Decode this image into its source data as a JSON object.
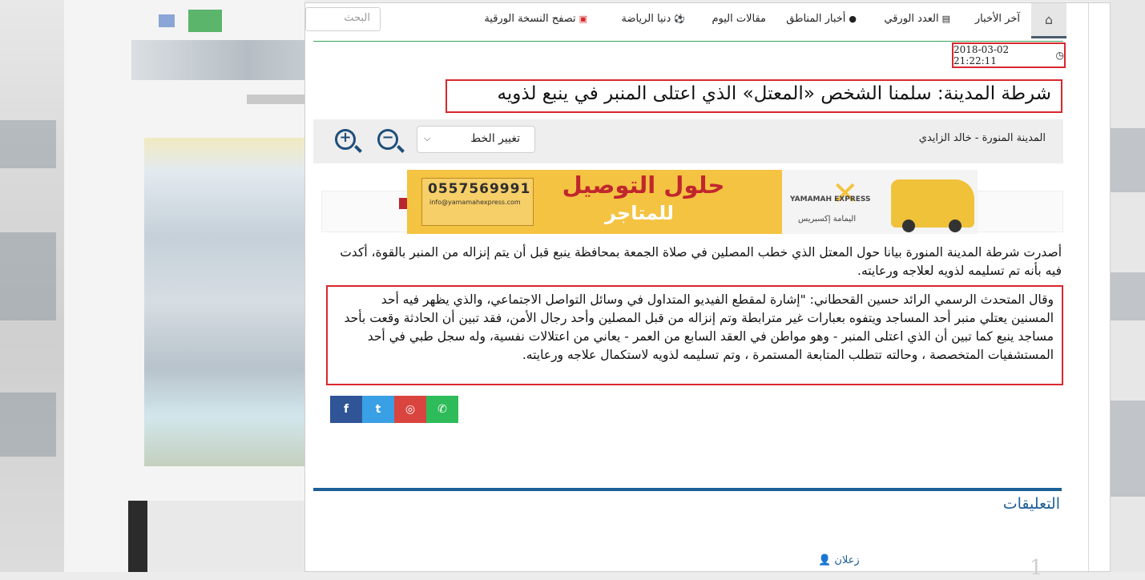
{
  "nav": {
    "home_icon": "home-icon",
    "items": [
      {
        "label": "آخر الأخبار",
        "icon": ""
      },
      {
        "label": "العدد الورقي",
        "icon": "newspaper-icon"
      },
      {
        "label": "أخبار المناطق",
        "icon": "map-marker-icon"
      },
      {
        "label": "مقالات اليوم",
        "icon": ""
      },
      {
        "label": "دنيا الرياضة",
        "icon": "soccer-ball-icon"
      },
      {
        "label": "تصفح النسخة الورقية",
        "icon": "pdf-icon"
      }
    ],
    "search_placeholder": "البحث"
  },
  "article": {
    "datetime": "2018-03-02 21:22:11",
    "title": "شرطة المدينة: سلمنا الشخص «المعتل» الذي اعتلى المنبر في ينبع لذويه",
    "author": "المدينة المنورة - خالد الزايدي",
    "font_select": "تغيير الخط",
    "paragraph1": "أصدرت شرطة المدينة المنورة بيانا حول المعتل الذي خطب المصلين في صلاة الجمعة بمحافظة ينبع قبل أن يتم إنزاله من المنبر بالقوة، أكدت فيه بأنه تم تسليمه لذويه لعلاجه ورعايته.",
    "paragraph2": "وقال المتحدث الرسمي الرائد حسين القحطاني: \"إشارة لمقطع الفيديو المتداول في وسائل التواصل الاجتماعي، والذي يظهر فيه أحد المسنين يعتلي منبر أحد المساجد ويتفوه بعبارات غير مترابطة وتم إنزاله من قبل المصلين وأحد رجال الأمن، فقد تبين أن الحادثة وقعت بأحد مساجد ينبع كما تبين أن الذي اعتلى المنبر - وهو مواطن في العقد السابع من العمر - يعاني من اعتلالات نفسية، وله سجل طبي في أحد المستشفيات المتخصصة ، وحالته تتطلب المتابعة المستمرة ، وتم تسليمه لذويه لاستكمال علاجه ورعايته."
  },
  "ad": {
    "phone": "0557569991",
    "email": "info@yamamahexpress.com",
    "headline": "حلول التوصيل",
    "subline": "للمتاجر",
    "brand_en": "YAMAMAH EXPRESS",
    "brand_ar": "اليمامة إكسبريس"
  },
  "share": {
    "facebook": "f",
    "twitter": "t",
    "instagram": "◎",
    "whatsapp": "✆"
  },
  "comments": {
    "title": "التعليقات",
    "first_commenter": "زعلان",
    "first_number": "1"
  }
}
